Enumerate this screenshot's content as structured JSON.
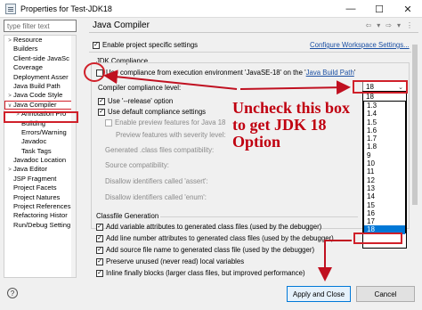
{
  "window": {
    "title": "Properties for Test-JDK18",
    "controls": [
      "—",
      "☐",
      "✕"
    ]
  },
  "filter": {
    "placeholder": "type filter text"
  },
  "tree": [
    {
      "label": "Resource",
      "arrow": ">",
      "indent": 0
    },
    {
      "label": "Builders",
      "arrow": "",
      "indent": 0
    },
    {
      "label": "Client-side JavaSc",
      "arrow": "",
      "indent": 0
    },
    {
      "label": "Coverage",
      "arrow": "",
      "indent": 0
    },
    {
      "label": "Deployment Asser",
      "arrow": "",
      "indent": 0
    },
    {
      "label": "Java Build Path",
      "arrow": "",
      "indent": 0
    },
    {
      "label": "Java Code Style",
      "arrow": ">",
      "indent": 0
    },
    {
      "label": "Java Compiler",
      "arrow": "∨",
      "indent": 0,
      "selected": true
    },
    {
      "label": "Annotation Pro",
      "arrow": ">",
      "indent": 1
    },
    {
      "label": "Building",
      "arrow": "",
      "indent": 1
    },
    {
      "label": "Errors/Warning",
      "arrow": "",
      "indent": 1
    },
    {
      "label": "Javadoc",
      "arrow": "",
      "indent": 1
    },
    {
      "label": "Task Tags",
      "arrow": "",
      "indent": 1
    },
    {
      "label": "Javadoc Location",
      "arrow": "",
      "indent": 0
    },
    {
      "label": "Java Editor",
      "arrow": ">",
      "indent": 0
    },
    {
      "label": "JSP Fragment",
      "arrow": "",
      "indent": 0
    },
    {
      "label": "Project Facets",
      "arrow": "",
      "indent": 0
    },
    {
      "label": "Project Natures",
      "arrow": "",
      "indent": 0
    },
    {
      "label": "Project References",
      "arrow": "",
      "indent": 0
    },
    {
      "label": "Refactoring Histor",
      "arrow": "",
      "indent": 0
    },
    {
      "label": "Run/Debug Setting",
      "arrow": "",
      "indent": 0
    }
  ],
  "page": {
    "title": "Java Compiler",
    "nav": [
      "⇦",
      "▾",
      "⇨",
      "▾",
      "⋮"
    ],
    "enable_specific": "Enable project specific settings",
    "configure_link": "Configure Workspace Settings...",
    "jdk_group": "JDK Compliance",
    "use_compliance_prefix": "Use compliance from execution environment 'JavaSE-18' on the '",
    "java_build_path_link": "Java Build Path",
    "use_compliance_suffix": "'",
    "compliance_level_label": "Compiler compliance level:",
    "compliance_value": "18",
    "release_option": "Use '--release' option",
    "default_compliance": "Use default compliance settings",
    "preview_features": "Enable preview features for Java 18",
    "preview_severity": "Preview features with severity level:",
    "generated_compat": "Generated .class files compatibility:",
    "source_compat": "Source compatibility:",
    "disallow_assert": "Disallow identifiers called 'assert':",
    "disallow_enum": "Disallow identifiers called 'enum':",
    "classfile_group": "Classfile Generation",
    "opt_variable_attrs": "Add variable attributes to generated class files (used by the debugger)",
    "opt_line_numbers": "Add line number attributes to generated class files (used by the debugger)",
    "opt_source_file": "Add source file name to generated class file (used by the debugger)",
    "opt_preserve_locals": "Preserve unused (never read) local variables",
    "opt_inline_finally": "Inline finally blocks (larger class files, but improved performance)"
  },
  "dropdown": {
    "selected": "18",
    "options": [
      "1.3",
      "1.4",
      "1.5",
      "1.6",
      "1.7",
      "1.8",
      "9",
      "10",
      "11",
      "12",
      "13",
      "14",
      "15",
      "16",
      "17",
      "18"
    ]
  },
  "annotation": {
    "lines": [
      "Uncheck this box",
      "to get JDK 18",
      "Option"
    ],
    "color": "#c00010"
  },
  "buttons": {
    "help": "?",
    "apply_close": "Apply and Close",
    "cancel": "Cancel"
  }
}
